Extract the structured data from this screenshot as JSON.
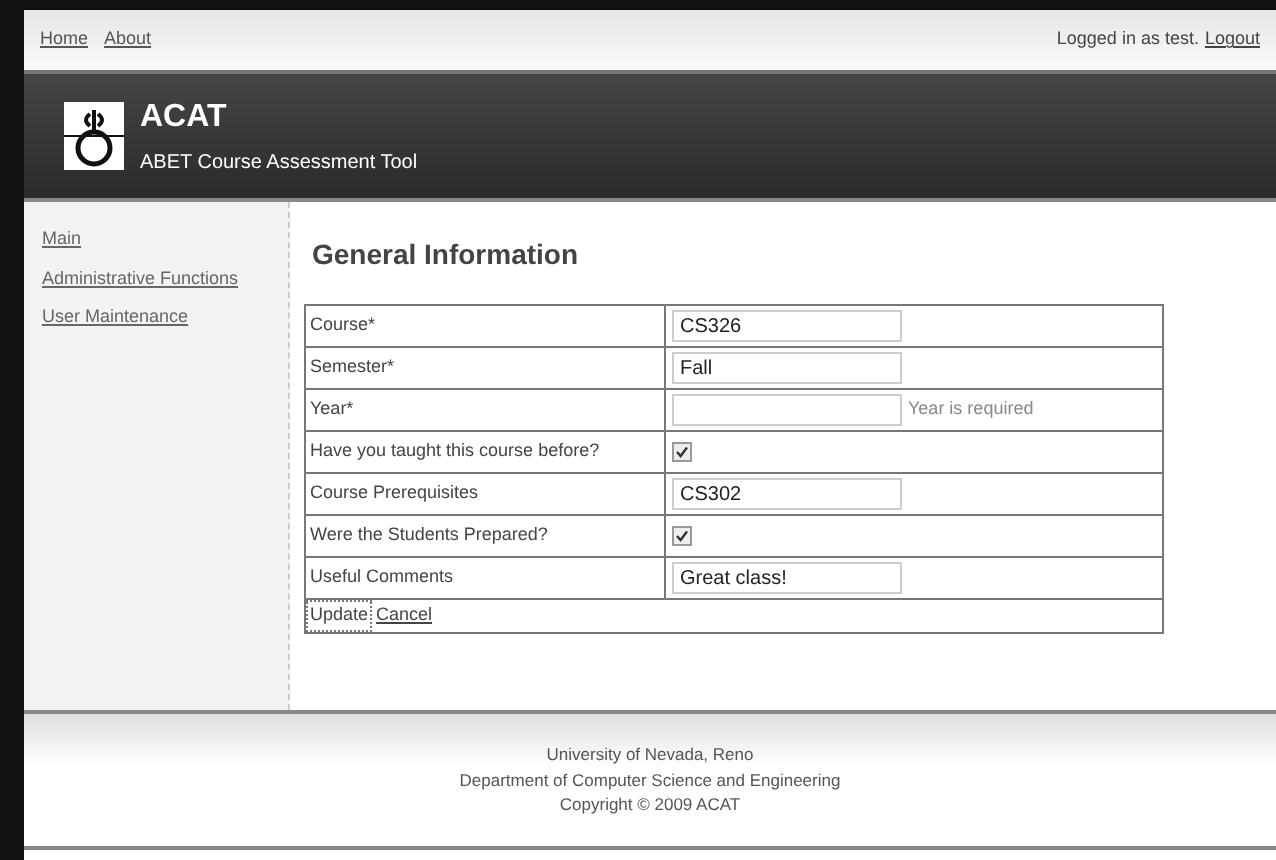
{
  "top_nav": {
    "links": [
      "Home",
      "About"
    ],
    "login_text": "Logged in as test.",
    "logout": "Logout"
  },
  "header": {
    "title": "ACAT",
    "subtitle": "ABET Course Assessment Tool"
  },
  "sidebar": {
    "items": [
      "Main",
      "Administrative Functions",
      "User Maintenance"
    ]
  },
  "heading": "General Information",
  "form": {
    "rows": [
      {
        "label": "Course*",
        "kind": "text",
        "value": "CS326"
      },
      {
        "label": "Semester*",
        "kind": "text",
        "value": "Fall"
      },
      {
        "label": "Year*",
        "kind": "text",
        "value": "",
        "error": "Year is required"
      },
      {
        "label": "Have you taught this course before?",
        "kind": "checkbox",
        "checked": true
      },
      {
        "label": "Course Prerequisites",
        "kind": "text",
        "value": "CS302"
      },
      {
        "label": "Were the Students Prepared?",
        "kind": "checkbox",
        "checked": true
      },
      {
        "label": "Useful Comments",
        "kind": "text",
        "value": "Great class!"
      }
    ],
    "actions": [
      "Update",
      "Cancel"
    ]
  },
  "footer": [
    "University of Nevada, Reno",
    "Department of Computer Science and Engineering",
    "Copyright © 2009 ACAT"
  ]
}
